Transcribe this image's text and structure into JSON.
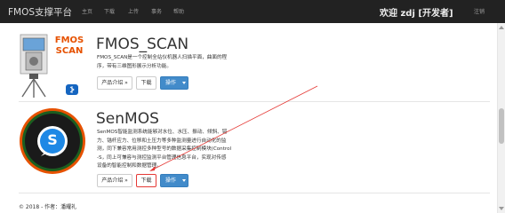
{
  "navbar": {
    "brand": "FMOS支撑平台",
    "items": [
      "主页",
      "下载",
      "上传",
      "事务",
      "帮助"
    ],
    "welcome": "欢迎 zdj [开发者]",
    "logout": "注销"
  },
  "products": [
    {
      "title": "FMOS_SCAN",
      "logo_text": "FMOS\nSCAN",
      "description": [
        "FMOS_SCAN是一个控制全站仪机器人扫描平面，曲面的程",
        "序，带有三维图形展示分析功能。"
      ],
      "buttons": {
        "intro": "产品介绍 »",
        "download": "下载",
        "action": "操作"
      }
    },
    {
      "title": "SenMOS",
      "logo_text": "S",
      "description": [
        "SenMOS智能监测系统能够对水位、水压、振动、倾斜、错",
        "力、锚杆应力、位移和土压力等多种监测量进行自动化的监",
        "测，同下兼容常用测控多种型号的数据采集控制模块(Control",
        "-S，同上可兼容与测控监测平台管理信息平台，实现对传感",
        "设备的智能控制和数据管理。"
      ],
      "buttons": {
        "intro": "产品介绍 »",
        "download": "下载",
        "action": "操作"
      }
    }
  ],
  "footer": "© 2018 - 作者：潘耀礼",
  "colors": {
    "navbar": "#222222",
    "primary": "#428bca",
    "highlight": "#e53935",
    "logo_blue": "#1e88e5",
    "logo_bg": "#1a1a1a",
    "ring": "#ff6f00",
    "ring2": "#2e7d32"
  }
}
